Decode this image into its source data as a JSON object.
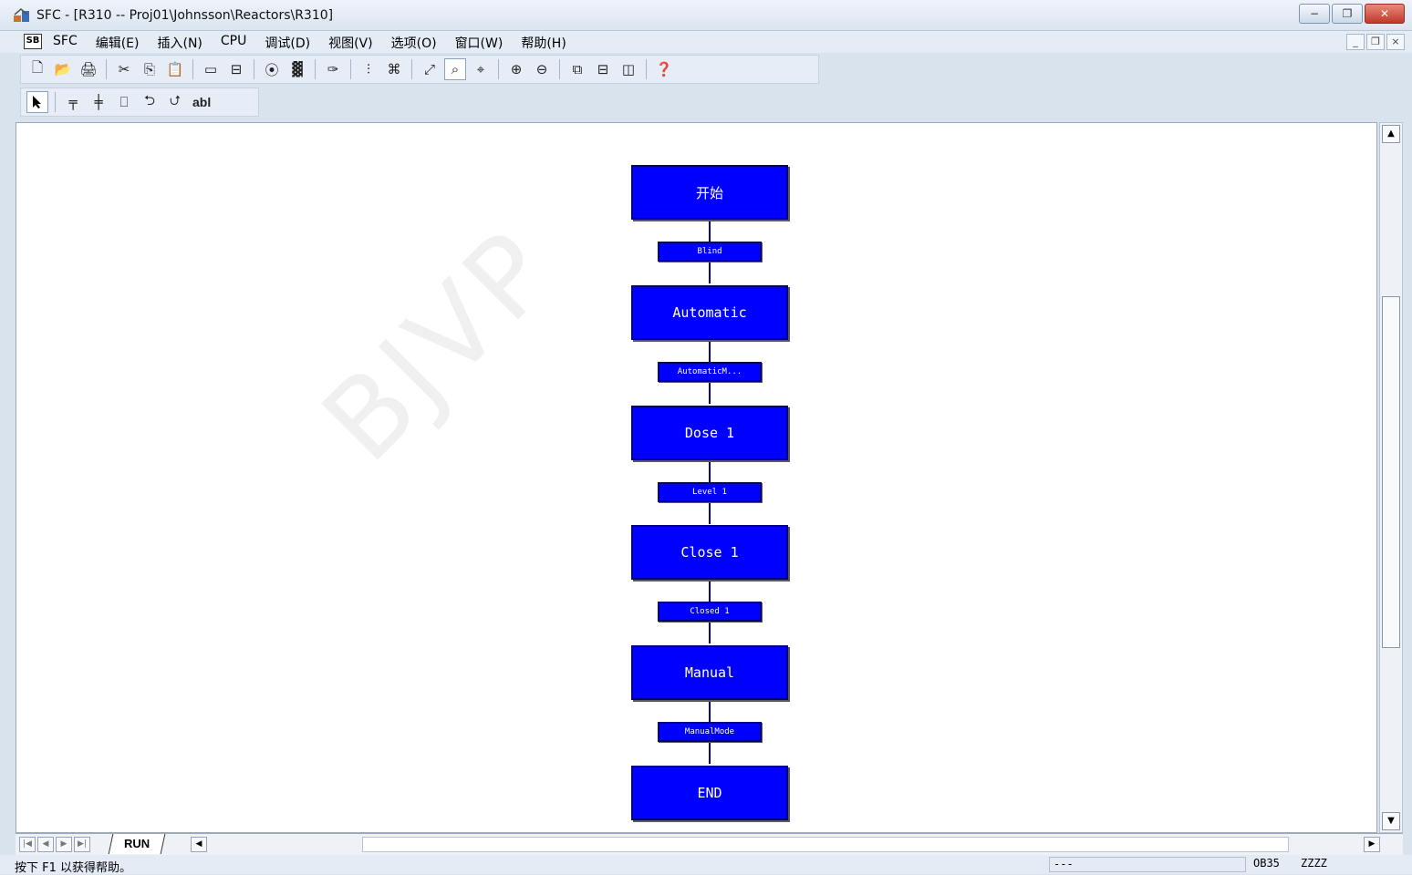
{
  "window": {
    "title": "SFC - [R310 -- Proj01\\Johnsson\\Reactors\\R310]",
    "minimize": "−",
    "restore": "❐",
    "close": "✕"
  },
  "menu": {
    "app_icon_label": "SB",
    "items": [
      "SFC",
      "编辑(E)",
      "插入(N)",
      "CPU",
      "调试(D)",
      "视图(V)",
      "选项(O)",
      "窗口(W)",
      "帮助(H)"
    ],
    "mdi_minimize": "_",
    "mdi_restore": "❐",
    "mdi_close": "×"
  },
  "toolbar1": {
    "icons": [
      "🗋",
      "📂",
      "🖨",
      "✂",
      "⎘",
      "📋",
      "▭",
      "⊟",
      "⦿",
      "▓",
      "✑",
      "⫶",
      "⌘",
      "⤢",
      "⌕",
      "⌖",
      "⊕",
      "⊖",
      "⧉",
      "⊟",
      "◫",
      "❓"
    ]
  },
  "toolbar2": {
    "icons": [
      "▲",
      "╤",
      "╪",
      "⎕",
      "⮌",
      "⮍"
    ],
    "text_tool": "abl"
  },
  "sfc": {
    "steps": [
      "开始",
      "Automatic",
      "Dose 1",
      "Close 1",
      "Manual",
      "END"
    ],
    "transitions": [
      "Blind",
      "AutomaticM...",
      "Level 1",
      "Closed 1",
      "ManualMode"
    ]
  },
  "watermark": "BJVP",
  "scrollbar": {
    "up": "▲",
    "down": "▼"
  },
  "tabbar": {
    "nav": [
      "|◀",
      "◀",
      "▶",
      "▶|"
    ],
    "active_tab": "RUN",
    "hscroll_left": "◀",
    "hscroll_right": "▶"
  },
  "status": {
    "help_text": "按下 F1 以获得帮助。",
    "panel1": "---",
    "panel2": "OB35",
    "panel3": "ZZZZ"
  }
}
